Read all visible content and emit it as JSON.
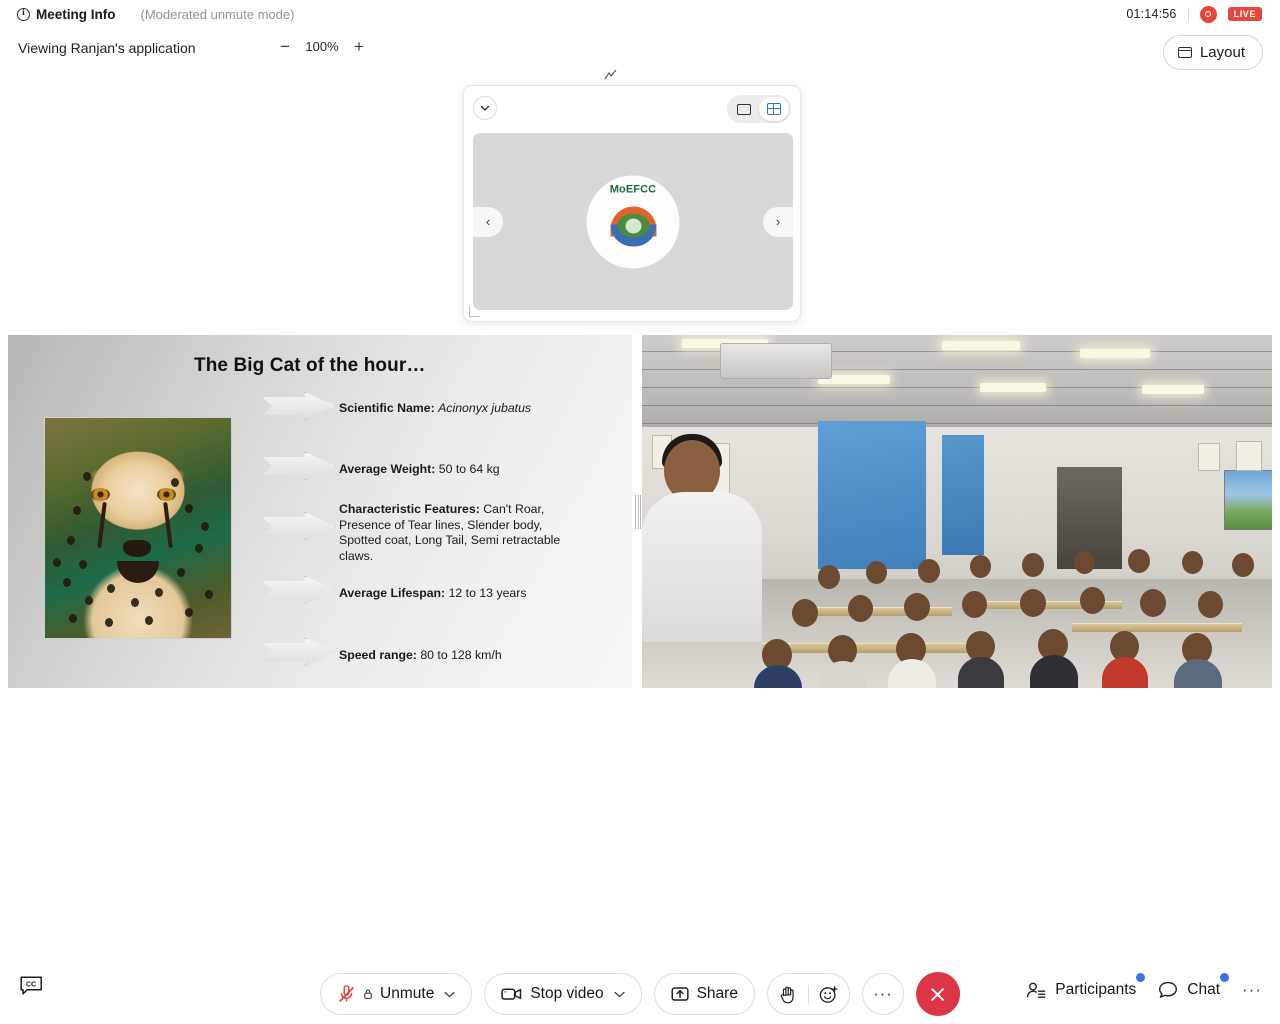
{
  "topbar": {
    "meeting_info_label": "Meeting Info",
    "info_icon_char": "i",
    "moderated_mode": "(Moderated unmute mode)",
    "timer": "01:14:56",
    "live_badge": "LIVE"
  },
  "subbar": {
    "viewing_label": "Viewing Ranjan's application",
    "zoom_out": "−",
    "zoom_value": "100%",
    "zoom_in": "+",
    "resize_glyph": "⤵",
    "layout_label": "Layout"
  },
  "float_panel": {
    "collapse_icon": "chevron-down-icon",
    "view_single_label": "single-view",
    "view_grid_label": "grid-view",
    "prev_arrow": "‹",
    "next_arrow": "›",
    "avatar": {
      "title": "MoEFCC",
      "emblem_name": "government-emblem"
    }
  },
  "slide": {
    "title": "The Big Cat of the hour…",
    "image_alt": "cheetah-photo",
    "bullets": [
      {
        "label": "Scientific Name:",
        "value": "Acinonyx jubatus",
        "italic": true
      },
      {
        "label": "Average Weight:",
        "value": "50 to 64 kg",
        "italic": false
      },
      {
        "label": "Characteristic Features:",
        "value": "Can't Roar, Presence of Tear lines, Slender body, Spotted coat, Long Tail, Semi retractable claws.",
        "italic": false
      },
      {
        "label": "Average Lifespan:",
        "value": "12 to 13 years",
        "italic": false
      },
      {
        "label": "Speed range:",
        "value": "80 to 128 km/h",
        "italic": false
      }
    ]
  },
  "camera": {
    "alt": "classroom-audience-video"
  },
  "bottombar": {
    "captions_icon_label": "CC",
    "unmute": {
      "label": "Unmute",
      "chevron": "⌄"
    },
    "video": {
      "label": "Stop video",
      "chevron": "⌄"
    },
    "share": {
      "label": "Share"
    },
    "raise_hand": "raise-hand",
    "reactions": "reactions",
    "more": "···",
    "leave": "leave-meeting",
    "participants": {
      "label": "Participants",
      "has_badge": true
    },
    "chat": {
      "label": "Chat",
      "has_badge": true
    },
    "overflow": "···"
  },
  "colors": {
    "live_red": "#e8453c",
    "leave_red": "#dc3545",
    "badge_blue": "#3b6fe0",
    "grid_active_blue": "#2f6fd0",
    "mute_red": "#e03a2f"
  }
}
